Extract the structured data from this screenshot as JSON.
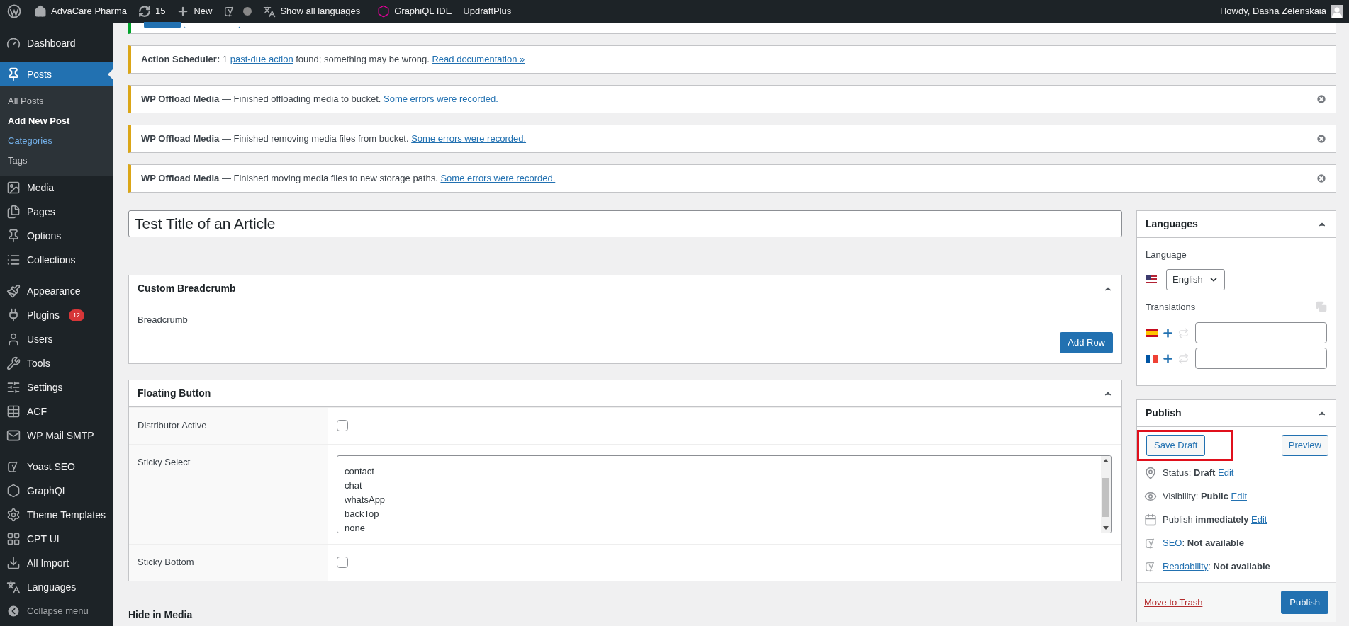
{
  "top_bar": {
    "site": "AdvaCare Pharma",
    "updates": "15",
    "new": "New",
    "languages": "Show all languages",
    "graphql": "GraphiQL IDE",
    "updraft": "UpdraftPlus",
    "greeting": "Howdy, Dasha Zelenskaia"
  },
  "sidebar": {
    "groups": [
      [
        {
          "label": "Dashboard",
          "selected": false
        }
      ],
      [
        {
          "label": "Posts",
          "selected": true,
          "children": [
            {
              "label": "All Posts",
              "selected": false,
              "hovered": false
            },
            {
              "label": "Add New Post",
              "selected": true,
              "hovered": false
            },
            {
              "label": "Categories",
              "selected": false,
              "hovered": true
            },
            {
              "label": "Tags",
              "selected": false,
              "hovered": false
            }
          ]
        },
        {
          "label": "Media",
          "selected": false
        },
        {
          "label": "Pages",
          "selected": false
        },
        {
          "label": "Options",
          "selected": false
        },
        {
          "label": "Collections",
          "selected": false
        }
      ],
      [
        {
          "label": "Appearance",
          "selected": false
        },
        {
          "label": "Plugins",
          "selected": false,
          "badge": "12"
        },
        {
          "label": "Users",
          "selected": false
        },
        {
          "label": "Tools",
          "selected": false
        },
        {
          "label": "Settings",
          "selected": false
        },
        {
          "label": "ACF",
          "selected": false
        },
        {
          "label": "WP Mail SMTP",
          "selected": false
        }
      ],
      [
        {
          "label": "Yoast SEO",
          "selected": false
        },
        {
          "label": "GraphQL",
          "selected": false
        },
        {
          "label": "Theme Templates",
          "selected": false
        },
        {
          "label": "CPT UI",
          "selected": false
        },
        {
          "label": "All Import",
          "selected": false
        },
        {
          "label": "Languages",
          "selected": false
        }
      ]
    ],
    "collapse": "Collapse menu"
  },
  "notices": [
    {
      "kind": "success_partial",
      "dismissible": false
    },
    {
      "kind": "warning",
      "dismissible": false,
      "segments": [
        {
          "text": "**Action Scheduler:** 1 ",
          "link": false
        },
        {
          "text": "past-due action",
          "link": true
        },
        {
          "text": " found; something may be wrong. ",
          "link": false
        },
        {
          "text": "Read documentation »",
          "link": true
        }
      ]
    },
    {
      "kind": "warning",
      "dismissible": true,
      "segments": [
        {
          "text": "**WP Offload Media** — Finished offloading media to bucket. ",
          "link": false
        },
        {
          "text": "Some errors were recorded.",
          "link": true
        }
      ]
    },
    {
      "kind": "warning",
      "dismissible": true,
      "segments": [
        {
          "text": "**WP Offload Media** — Finished removing media files from bucket. ",
          "link": false
        },
        {
          "text": "Some errors were recorded.",
          "link": true
        }
      ]
    },
    {
      "kind": "warning",
      "dismissible": true,
      "segments": [
        {
          "text": "**WP Offload Media** — Finished moving media files to new storage paths. ",
          "link": false
        },
        {
          "text": "Some errors were recorded.",
          "link": true
        }
      ]
    }
  ],
  "title_field": {
    "value": "Test Title of an Article"
  },
  "custom_breadcrumb": {
    "title": "Custom Breadcrumb",
    "label": "Breadcrumb",
    "button": "Add Row"
  },
  "floating_button": {
    "title": "Floating Button",
    "fields": [
      {
        "kind": "checkbox",
        "label": "Distributor Active",
        "checked": false
      },
      {
        "kind": "listbox",
        "label": "Sticky Select",
        "options": [
          "contact",
          "chat",
          "whatsApp",
          "backTop",
          "none"
        ]
      },
      {
        "kind": "checkbox",
        "label": "Sticky Bottom",
        "checked": false
      }
    ]
  },
  "hide_in_media": "Hide in Media",
  "languages_box": {
    "title": "Languages",
    "language_label": "Language",
    "language": "English",
    "translations_label": "Translations",
    "translations": [
      {
        "linked": false
      },
      {
        "linked": false
      }
    ]
  },
  "publish_box": {
    "title": "Publish",
    "save_draft": {
      "label": "Save Draft",
      "annotated": true
    },
    "preview": "Preview",
    "rows": [
      {
        "kind": "status",
        "segments": [
          {
            "text": "Status: **Draft** ",
            "link": false
          },
          {
            "text": "Edit",
            "link": true
          }
        ]
      },
      {
        "kind": "visibility",
        "segments": [
          {
            "text": "Visibility: **Public** ",
            "link": false
          },
          {
            "text": "Edit",
            "link": true
          }
        ]
      },
      {
        "kind": "schedule",
        "segments": [
          {
            "text": "Publish **immediately** ",
            "link": false
          },
          {
            "text": "Edit",
            "link": true
          }
        ]
      },
      {
        "kind": "seo",
        "segments": [
          {
            "text": "SEO",
            "link": true
          },
          {
            "text": ": **Not available**",
            "link": false
          }
        ]
      },
      {
        "kind": "readability",
        "segments": [
          {
            "text": "Readability",
            "link": true
          },
          {
            "text": ": **Not available**",
            "link": false
          }
        ]
      }
    ],
    "trash": "Move to Trash",
    "publish": "Publish"
  }
}
